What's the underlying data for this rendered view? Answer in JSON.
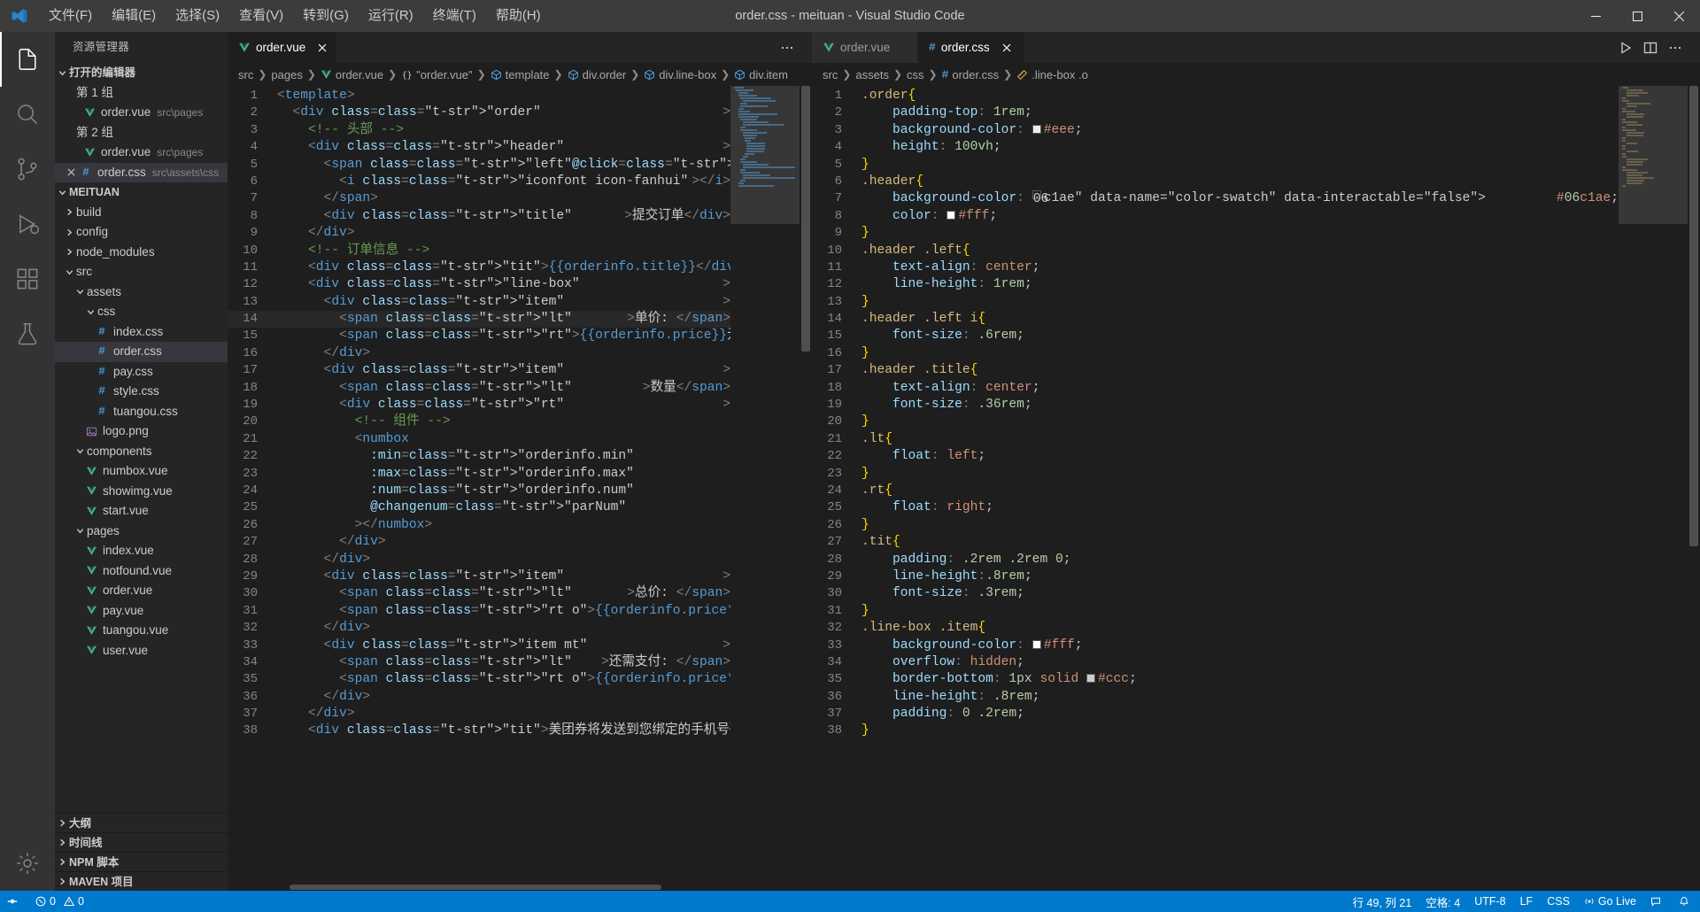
{
  "titlebar": {
    "window_title": "order.css - meituan - Visual Studio Code",
    "menu": [
      {
        "label": "文件(F)"
      },
      {
        "label": "编辑(E)"
      },
      {
        "label": "选择(S)"
      },
      {
        "label": "查看(V)"
      },
      {
        "label": "转到(G)"
      },
      {
        "label": "运行(R)"
      },
      {
        "label": "终端(T)"
      },
      {
        "label": "帮助(H)"
      }
    ],
    "window_controls": [
      "minimize",
      "maximize",
      "close"
    ]
  },
  "activitybar": {
    "items": [
      {
        "name": "explorer",
        "icon": "files-icon",
        "active": true
      },
      {
        "name": "search",
        "icon": "search-icon",
        "active": false
      },
      {
        "name": "source-control",
        "icon": "source-control-icon",
        "active": false
      },
      {
        "name": "run-debug",
        "icon": "run-debug-icon",
        "active": false
      },
      {
        "name": "extensions",
        "icon": "extensions-icon",
        "active": false
      },
      {
        "name": "testing",
        "icon": "beaker-icon",
        "active": false
      }
    ],
    "bottom": [
      {
        "name": "manage",
        "icon": "gear-icon"
      }
    ]
  },
  "sidebar": {
    "title": "资源管理器",
    "open_editors": {
      "label": "打开的编辑器",
      "expanded": true,
      "groups": [
        {
          "label": "第 1 组",
          "files": [
            {
              "name": "order.vue",
              "path": "src\\pages",
              "icon": "vue-icon",
              "selected": false
            }
          ]
        },
        {
          "label": "第 2 组",
          "files": [
            {
              "name": "order.vue",
              "path": "src\\pages",
              "icon": "vue-icon",
              "selected": false
            },
            {
              "name": "order.css",
              "path": "src\\assets\\css",
              "icon": "css-icon",
              "selected": true
            }
          ]
        }
      ]
    },
    "project": {
      "label": "MEITUAN",
      "expanded": true,
      "tree": [
        {
          "label": "build",
          "type": "folder",
          "expanded": false,
          "depth": 1
        },
        {
          "label": "config",
          "type": "folder",
          "expanded": false,
          "depth": 1
        },
        {
          "label": "node_modules",
          "type": "folder",
          "expanded": false,
          "depth": 1
        },
        {
          "label": "src",
          "type": "folder",
          "expanded": true,
          "depth": 1
        },
        {
          "label": "assets",
          "type": "folder",
          "expanded": true,
          "depth": 2
        },
        {
          "label": "css",
          "type": "folder",
          "expanded": true,
          "depth": 3
        },
        {
          "label": "index.css",
          "type": "css",
          "depth": 4
        },
        {
          "label": "order.css",
          "type": "css",
          "depth": 4,
          "selected": true
        },
        {
          "label": "pay.css",
          "type": "css",
          "depth": 4
        },
        {
          "label": "style.css",
          "type": "css",
          "depth": 4
        },
        {
          "label": "tuangou.css",
          "type": "css",
          "depth": 4
        },
        {
          "label": "logo.png",
          "type": "image",
          "depth": 3
        },
        {
          "label": "components",
          "type": "folder",
          "expanded": true,
          "depth": 2
        },
        {
          "label": "numbox.vue",
          "type": "vue",
          "depth": 3
        },
        {
          "label": "showimg.vue",
          "type": "vue",
          "depth": 3
        },
        {
          "label": "start.vue",
          "type": "vue",
          "depth": 3
        },
        {
          "label": "pages",
          "type": "folder",
          "expanded": true,
          "depth": 2
        },
        {
          "label": "index.vue",
          "type": "vue",
          "depth": 3
        },
        {
          "label": "notfound.vue",
          "type": "vue",
          "depth": 3
        },
        {
          "label": "order.vue",
          "type": "vue",
          "depth": 3
        },
        {
          "label": "pay.vue",
          "type": "vue",
          "depth": 3
        },
        {
          "label": "tuangou.vue",
          "type": "vue",
          "depth": 3
        },
        {
          "label": "user.vue",
          "type": "vue",
          "depth": 3
        }
      ]
    },
    "panels": [
      {
        "label": "大纲",
        "expanded": false
      },
      {
        "label": "时间线",
        "expanded": false
      },
      {
        "label": "NPM 脚本",
        "expanded": false
      },
      {
        "label": "MAVEN 项目",
        "expanded": false
      }
    ]
  },
  "editor_groups": [
    {
      "name": "left",
      "tabs": [
        {
          "label": "order.vue",
          "icon": "vue-icon",
          "active": true,
          "closable": true
        }
      ],
      "overflow_label": "…",
      "breadcrumbs": [
        {
          "label": "src",
          "icon": null
        },
        {
          "label": "pages",
          "icon": null
        },
        {
          "label": "order.vue",
          "icon": "vue-icon"
        },
        {
          "label": "\"order.vue\"",
          "icon": "braces-icon"
        },
        {
          "label": "template",
          "icon": "cube-icon"
        },
        {
          "label": "div.order",
          "icon": "cube-icon"
        },
        {
          "label": "div.line-box",
          "icon": "cube-icon"
        },
        {
          "label": "div.item",
          "icon": "cube-icon"
        }
      ],
      "first_line": 1,
      "highlight_line": 14,
      "lines": [
        "<template>",
        "  <div class=\"order\">",
        "    <!-- 头部 -->",
        "    <div class=\"header\">",
        "      <span class=\"left\" @click=\"back\">",
        "        <i class=\"iconfont icon-fanhui\"></i>",
        "      </span>",
        "      <div class=\"title\">提交订单</div>",
        "    </div>",
        "    <!-- 订单信息 -->",
        "    <div class=\"tit\">{{orderinfo.title}}</div>",
        "    <div class=\"line-box\">",
        "      <div class=\"item\">",
        "        <span class=\"lt\">单价: </span>",
        "        <span class=\"rt\">{{orderinfo.price}}元</span>",
        "      </div>",
        "      <div class=\"item\">",
        "        <span class=\"lt\">数量</span>",
        "        <div class=\"rt\">",
        "          <!-- 组件 -->",
        "          <numbox",
        "            :min=\"orderinfo.min\"",
        "            :max=\"orderinfo.max\"",
        "            :num=\"orderinfo.num\"",
        "            @changenum=\"parNum\"",
        "          ></numbox>",
        "        </div>",
        "      </div>",
        "      <div class=\"item\">",
        "        <span class=\"lt\">总价: </span>",
        "        <span class=\"rt o\">{{orderinfo.price*orderinfo.num}}元</sp",
        "      </div>",
        "      <div class=\"item mt\">",
        "        <span class=\"lt\">还需支付: </span>",
        "        <span class=\"rt o\">{{orderinfo.price*orderinfo.num}}元</sp",
        "      </div>",
        "    </div>",
        "    <div class=\"tit\">美团券将发送到您绑定的手机号码</div>"
      ]
    },
    {
      "name": "right",
      "tabs": [
        {
          "label": "order.vue",
          "icon": "vue-icon",
          "active": false,
          "closable": false
        },
        {
          "label": "order.css",
          "icon": "css-icon",
          "active": true,
          "closable": true
        }
      ],
      "breadcrumbs": [
        {
          "label": "src",
          "icon": null
        },
        {
          "label": "assets",
          "icon": null
        },
        {
          "label": "css",
          "icon": null
        },
        {
          "label": "order.css",
          "icon": "css-icon"
        },
        {
          "label": ".line-box .o",
          "icon": "ruler-icon"
        }
      ],
      "actions": [
        "run-icon",
        "split-editor-icon",
        "more-icon"
      ],
      "first_line": 1,
      "lines": [
        ".order{",
        "    padding-top: 1rem;",
        "    background-color: #eee;",
        "    height: 100vh;",
        "}",
        ".header{",
        "    background-color: #06c1ae;",
        "    color: #fff;",
        "}",
        ".header .left{",
        "    text-align: center;",
        "    line-height: 1rem;",
        "}",
        ".header .left i{",
        "    font-size: .6rem;",
        "}",
        ".header .title{",
        "    text-align: center;",
        "    font-size: .36rem;",
        "}",
        ".lt{",
        "    float: left;",
        "}",
        ".rt{",
        "    float: right;",
        "}",
        ".tit{",
        "    padding: .2rem .2rem 0;",
        "    line-height:.8rem;",
        "    font-size: .3rem;",
        "}",
        ".line-box .item{",
        "    background-color: #fff;",
        "    overflow: hidden;",
        "    border-bottom: 1px solid #ccc;",
        "    line-height: .8rem;",
        "    padding: 0 .2rem;",
        "}"
      ],
      "color_swatches": {
        "eee": "#eeeeee",
        "06c1ae": "#06c1ae",
        "fff": "#ffffff",
        "ccc": "#cccccc"
      }
    }
  ],
  "statusbar": {
    "left": [
      {
        "name": "remote",
        "icon": "remote-icon",
        "label": ""
      },
      {
        "name": "problems",
        "icon": "error-icon",
        "label": "0",
        "icon2": "warning-icon",
        "label2": "0"
      }
    ],
    "problems_errors": "0",
    "problems_warnings": "0",
    "right": [
      {
        "name": "cursor-position",
        "label": "行 49, 列 21"
      },
      {
        "name": "indentation",
        "label": "空格: 4"
      },
      {
        "name": "encoding",
        "label": "UTF-8"
      },
      {
        "name": "eol",
        "label": "LF"
      },
      {
        "name": "language-mode",
        "label": "CSS"
      },
      {
        "name": "go-live",
        "label": "Go Live",
        "icon": "broadcast-icon"
      },
      {
        "name": "feedback",
        "label": "",
        "icon": "feedback-icon"
      },
      {
        "name": "notifications",
        "label": "",
        "icon": "bell-icon"
      }
    ]
  },
  "colors": {
    "accent": "#007acc",
    "titlebar_bg": "#3c3c3c",
    "sidebar_bg": "#252526",
    "editor_bg": "#1e1e1e",
    "activitybar_bg": "#333333"
  }
}
